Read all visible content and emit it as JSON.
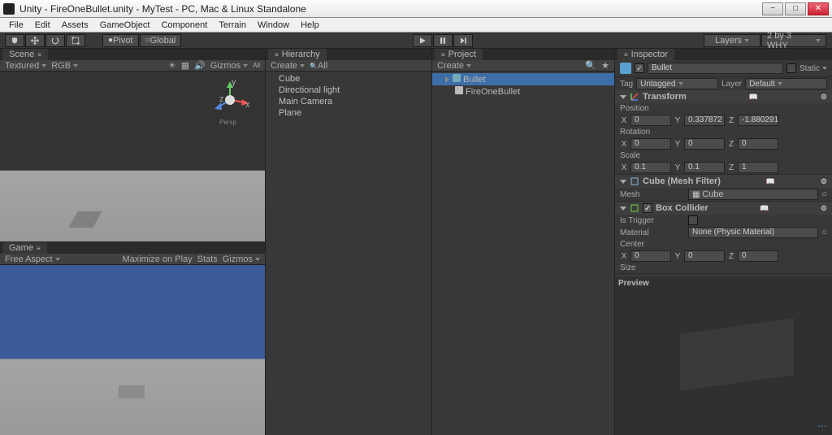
{
  "window": {
    "title": "Unity - FireOneBullet.unity - MyTest - PC, Mac & Linux Standalone"
  },
  "menu": [
    "File",
    "Edit",
    "Assets",
    "GameObject",
    "Component",
    "Terrain",
    "Window",
    "Help"
  ],
  "toolbar": {
    "pivot": "Pivot",
    "global": "Global",
    "layers": "Layers",
    "layout": "2 by 3 WHY"
  },
  "scene": {
    "tab": "Scene",
    "shading": "Textured",
    "rendermode": "RGB",
    "gizmos": "Gizmos",
    "all": "All",
    "axis": {
      "x": "x",
      "y": "y",
      "z": "z"
    },
    "persp": "Persp"
  },
  "game": {
    "tab": "Game",
    "aspect": "Free Aspect",
    "maximize": "Maximize on Play",
    "stats": "Stats",
    "gizmos": "Gizmos"
  },
  "hierarchy": {
    "tab": "Hierarchy",
    "create": "Create",
    "all": "All",
    "items": [
      "Cube",
      "Directional light",
      "Main Camera",
      "Plane"
    ]
  },
  "project": {
    "tab": "Project",
    "create": "Create",
    "items": [
      {
        "label": "Bullet",
        "selected": true,
        "child": false,
        "icon": "prefab"
      },
      {
        "label": "FireOneBullet",
        "selected": false,
        "child": true,
        "icon": "script"
      }
    ]
  },
  "inspector": {
    "tab": "Inspector",
    "name": "Bullet",
    "static": "Static",
    "tag_label": "Tag",
    "tag_value": "Untagged",
    "layer_label": "Layer",
    "layer_value": "Default",
    "transform": {
      "title": "Transform",
      "position": "Position",
      "rotation": "Rotation",
      "scale": "Scale",
      "pos": {
        "x": "0",
        "y": "0.337872",
        "z": "-1.880291"
      },
      "rot": {
        "x": "0",
        "y": "0",
        "z": "0"
      },
      "scl": {
        "x": "0.1",
        "y": "0.1",
        "z": "1"
      }
    },
    "meshfilter": {
      "title": "Cube (Mesh Filter)",
      "mesh_label": "Mesh",
      "mesh_value": "Cube"
    },
    "collider": {
      "title": "Box Collider",
      "is_trigger": "Is Trigger",
      "material": "Material",
      "material_value": "None (Physic Material)",
      "center": "Center",
      "size": "Size",
      "c": {
        "x": "0",
        "y": "0",
        "z": "0"
      }
    },
    "preview": "Preview"
  }
}
